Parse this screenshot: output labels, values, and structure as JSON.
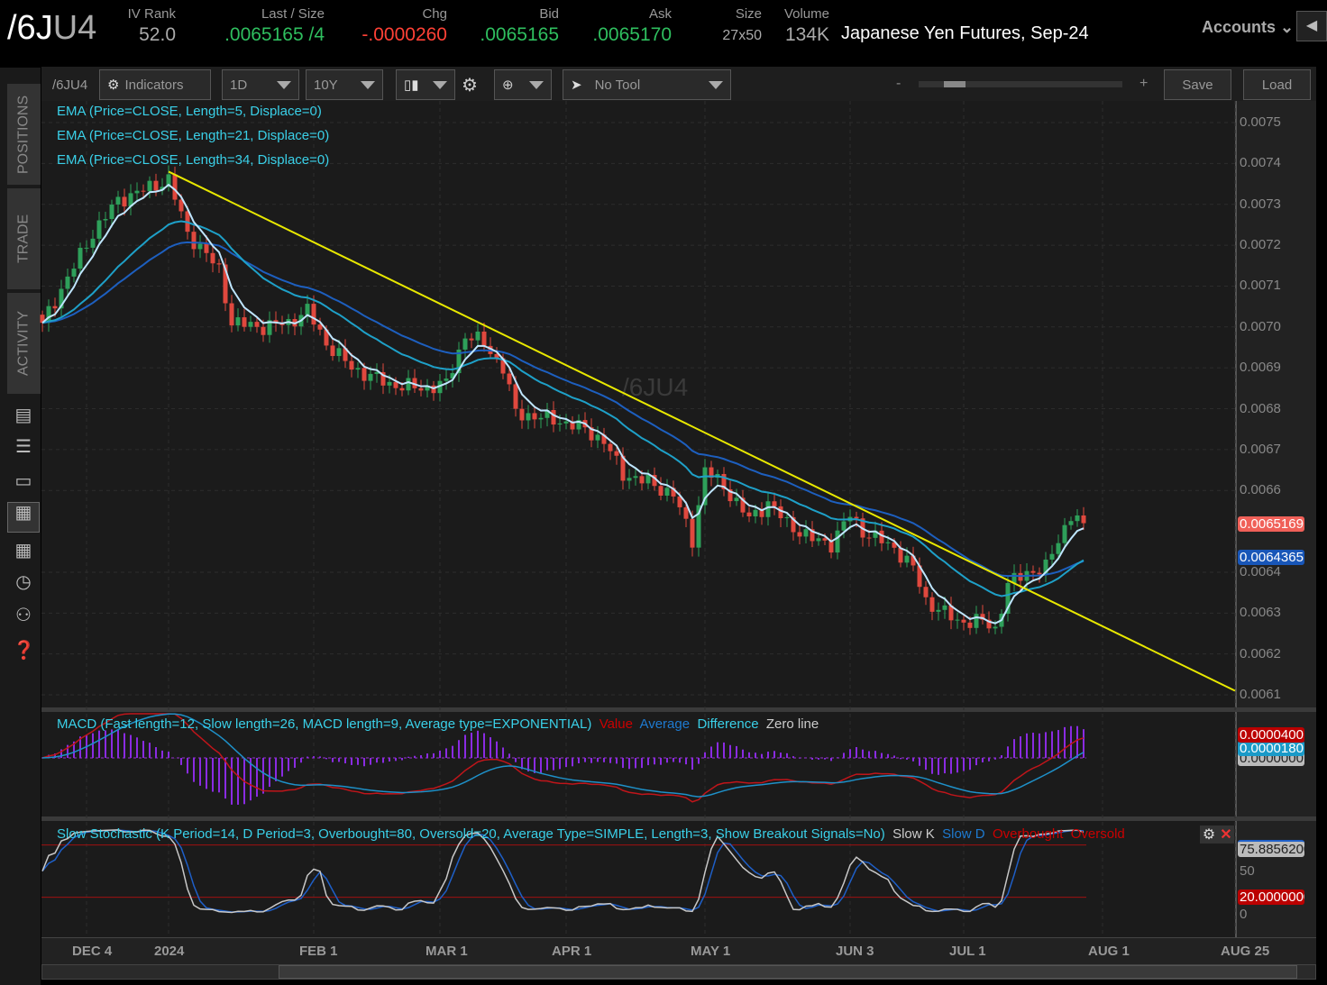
{
  "header": {
    "symbol_prefix": "/6J",
    "symbol_suffix": "U4",
    "fields": [
      {
        "label": "IV Rank",
        "value": "52.0",
        "color": "gray"
      },
      {
        "label": "Last / Size",
        "value": ".0065165 /4",
        "color": "green"
      },
      {
        "label": "Chg",
        "value": "-.0000260",
        "color": "red"
      },
      {
        "label": "Bid",
        "value": ".0065165",
        "color": "green"
      },
      {
        "label": "Ask",
        "value": ".0065170",
        "color": "green"
      },
      {
        "label": "Size",
        "value": "27x50",
        "color": "gray"
      },
      {
        "label": "Volume",
        "value": "134K",
        "color": "gray"
      }
    ],
    "description": "Japanese Yen Futures, Sep-24",
    "accounts": "Accounts"
  },
  "sidebar": {
    "tabs": [
      "POSITIONS",
      "TRADE",
      "ACTIVITY"
    ]
  },
  "toolbar": {
    "symbol": "/6JU4",
    "indicators": "Indicators",
    "aggregation": "1D",
    "timeframe": "10Y",
    "tool": "No Tool",
    "zoom_minus": "-",
    "zoom_plus": "+",
    "save": "Save",
    "load": "Load"
  },
  "price_panel": {
    "watermark": "/6JU4",
    "studies": [
      "EMA (Price=CLOSE, Length=5, Displace=0)",
      "EMA (Price=CLOSE, Length=21, Displace=0)",
      "EMA (Price=CLOSE, Length=34, Displace=0)"
    ],
    "axis_labels": [
      "0.0075",
      "0.0074",
      "0.0073",
      "0.0072",
      "0.0071",
      "0.0070",
      "0.0069",
      "0.0068",
      "0.0067",
      "0.0066",
      "0.0064",
      "0.0063",
      "0.0062",
      "0.0061"
    ],
    "last_price_tag": "0.0065169",
    "ema_tag": "0.0064365"
  },
  "macd_panel": {
    "title": "MACD (Fast length=12, Slow length=26, MACD length=9, Average type=EXPONENTIAL)",
    "legend": [
      "Value",
      "Average",
      "Difference",
      "Zero line"
    ],
    "tags": [
      "0.0000400",
      "0.0000180",
      "0.0000000"
    ]
  },
  "stoch_panel": {
    "title": "Slow Stochastic (K Period=14, D Period=3, Overbought=80, Oversold=20, Average Type=SIMPLE, Length=3, Show Breakout Signals=No)",
    "legend": [
      "Slow K",
      "Slow D",
      "Overbought",
      "Oversold"
    ],
    "tags": [
      "75.8856200",
      "20.0000000"
    ],
    "axis_labels": [
      "50",
      "0"
    ]
  },
  "date_axis": [
    {
      "label": "DEC 4",
      "day": 7
    },
    {
      "label": "2024",
      "day": 20
    },
    {
      "label": "FEB 1",
      "day": 43
    },
    {
      "label": "MAR 1",
      "day": 63
    },
    {
      "label": "APR 1",
      "day": 83
    },
    {
      "label": "MAY 1",
      "day": 105
    },
    {
      "label": "JUN 3",
      "day": 128
    },
    {
      "label": "JUL 1",
      "day": 146
    },
    {
      "label": "AUG 1",
      "day": 168
    },
    {
      "label": "AUG 25",
      "day": 189
    }
  ],
  "chart_data": {
    "type": "candlestick",
    "close_keypoints": [
      [
        0,
        0.00701
      ],
      [
        8,
        0.00723
      ],
      [
        12,
        0.00731
      ],
      [
        20,
        0.00736
      ],
      [
        23,
        0.00723
      ],
      [
        28,
        0.00714
      ],
      [
        30,
        0.00701
      ],
      [
        35,
        0.007
      ],
      [
        39,
        0.00701
      ],
      [
        42,
        0.00704
      ],
      [
        45,
        0.00696
      ],
      [
        49,
        0.0069
      ],
      [
        55,
        0.00686
      ],
      [
        60,
        0.00685
      ],
      [
        64,
        0.00686
      ],
      [
        67,
        0.00698
      ],
      [
        70,
        0.00696
      ],
      [
        73,
        0.0069
      ],
      [
        75,
        0.00679
      ],
      [
        82,
        0.00677
      ],
      [
        86,
        0.00675
      ],
      [
        89,
        0.00672
      ],
      [
        92,
        0.00664
      ],
      [
        96,
        0.00662
      ],
      [
        100,
        0.00659
      ],
      [
        103,
        0.00648
      ],
      [
        105,
        0.00665
      ],
      [
        108,
        0.00661
      ],
      [
        112,
        0.00653
      ],
      [
        115,
        0.00657
      ],
      [
        118,
        0.00652
      ],
      [
        122,
        0.00648
      ],
      [
        125,
        0.00647
      ],
      [
        128,
        0.00654
      ],
      [
        130,
        0.0065
      ],
      [
        135,
        0.00646
      ],
      [
        138,
        0.00641
      ],
      [
        140,
        0.00633
      ],
      [
        145,
        0.00628
      ],
      [
        149,
        0.00628
      ],
      [
        151,
        0.00626
      ],
      [
        153,
        0.00637
      ],
      [
        156,
        0.0064
      ],
      [
        159,
        0.00641
      ],
      [
        161,
        0.00648
      ],
      [
        163,
        0.00654
      ],
      [
        165,
        0.00652
      ]
    ],
    "ema_lengths": [
      5,
      21,
      34
    ],
    "trendline": [
      [
        20,
        0.00738
      ],
      [
        189,
        0.00611
      ]
    ],
    "ylim": [
      0.00607,
      0.00755
    ],
    "ema_colors": [
      "#bfe6ff",
      "#1ea0c8",
      "#1d5fbf"
    ],
    "trend_color": "#e8e800"
  }
}
